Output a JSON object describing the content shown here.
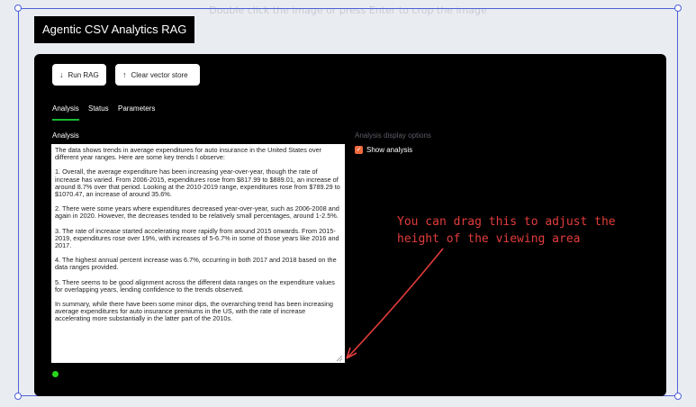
{
  "crop_hint": "Double click the image or press Enter to crop the image",
  "app_title": "Agentic CSV Analytics RAG",
  "toolbar": {
    "run_label": "Run RAG",
    "clear_label": "Clear vector store"
  },
  "tabs": [
    {
      "label": "Analysis",
      "active": true
    },
    {
      "label": "Status",
      "active": false
    },
    {
      "label": "Parameters",
      "active": false
    }
  ],
  "analysis_label": "Analysis",
  "display_options": {
    "label": "Analysis display options",
    "show_analysis_label": "Show analysis",
    "show_analysis_checked": true
  },
  "analysis_text": {
    "p1": "The data shows trends in average expenditures for auto insurance in the United States over different year ranges. Here are some key trends I observe:",
    "p2": "1. Overall, the average expenditure has been increasing year-over-year, though the rate of increase has varied. From 2006-2015, expenditures rose from $817.99 to $889.01, an increase of around 8.7% over that period. Looking at the 2010-2019 range, expenditures rose from $789.29 to $1070.47, an increase of around 35.6%.",
    "p3": "2. There were some years where expenditures decreased year-over-year, such as 2006-2008 and again in 2020. However, the decreases tended to be relatively small percentages, around 1-2.5%.",
    "p4": "3. The rate of increase started accelerating more rapidly from around 2015 onwards. From 2015-2019, expenditures rose over 19%, with increases of 5-6.7% in some of those years like 2016 and 2017.",
    "p5": "4. The highest annual percent increase was 6.7%, occurring in both 2017 and 2018 based on the data ranges provided.",
    "p6": "5. There seems to be good alignment across the different data ranges on the expenditure values for overlapping years, lending confidence to the trends observed.",
    "p7": "In summary, while there have been some minor dips, the overarching trend has been increasing average expenditures for auto insurance premiums in the US, with the rate of increase accelerating more substantially in the latter part of the 2010s."
  },
  "annotation": {
    "line1": "You can drag this to adjust the",
    "line2": "height of the viewing area"
  },
  "colors": {
    "accent_green": "#19b830",
    "status_green": "#27d61b",
    "checkbox_orange": "#f06a3e",
    "annotation_red": "#e23c3c",
    "selection_blue": "#4f5fd6"
  },
  "icons": {
    "run": "arrow-down-icon",
    "clear": "arrow-up-icon",
    "checkbox": "check-icon",
    "resize": "resize-grip-icon"
  }
}
